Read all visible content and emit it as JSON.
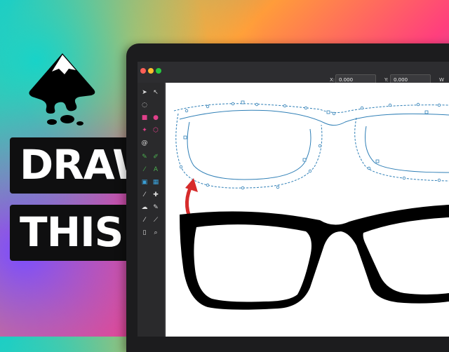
{
  "thumbnail": {
    "line1": "DRAW",
    "line2": "THIS"
  },
  "app": {
    "name": "Inkscape",
    "controls": {
      "x_label": "X:",
      "x_value": "0.000",
      "y_label": "Y:",
      "y_value": "0.000",
      "w_label": "W"
    }
  },
  "colors": {
    "outline_stroke": "#2f7fb6",
    "arrow": "#d62b2b",
    "glasses_fill": "#000000"
  },
  "icons": [
    "inkscape-logo-icon",
    "selector-icon",
    "node-tool-icon",
    "rectangle-icon",
    "ellipse-icon",
    "star-icon",
    "box3d-icon",
    "spiral-icon",
    "pencil-icon",
    "text-icon",
    "gradient-icon",
    "mesh-icon",
    "dropper-icon",
    "spray-icon",
    "eraser-icon",
    "zoom-icon",
    "measure-icon"
  ]
}
